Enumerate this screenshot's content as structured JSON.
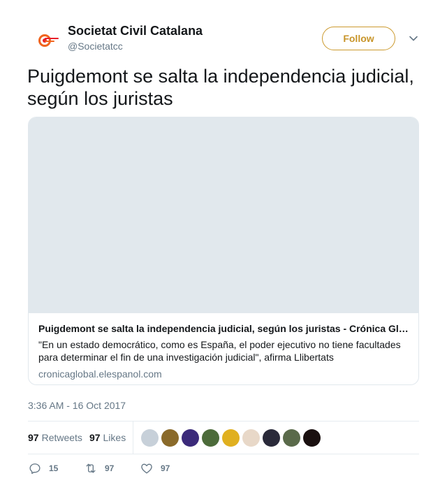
{
  "header": {
    "name": "Societat Civil Catalana",
    "handle": "@Societatcc",
    "follow_label": "Follow"
  },
  "tweet": {
    "text": "Puigdemont se salta la independencia judicial, según los juristas",
    "timestamp": "3:36 AM - 16 Oct 2017"
  },
  "card": {
    "title": "Puigdemont se salta la independencia judicial, según los juristas - Crónica Global",
    "description": "\"En un estado democrático, como es España, el poder ejecutivo no tiene facultades para determinar el fin de una investigación judicial\", afirma Llibertats",
    "domain": "cronicaglobal.elespanol.com"
  },
  "stats": {
    "retweets_count": "97",
    "retweets_label": "Retweets",
    "likes_count": "97",
    "likes_label": "Likes"
  },
  "liker_avatar_colors": [
    "#c7d0d9",
    "#8a6a2a",
    "#3b2a7a",
    "#4c6b3a",
    "#e0b020",
    "#e8d8c8",
    "#2a2a3a",
    "#5a6a4a",
    "#1a1010"
  ],
  "actions": {
    "reply_count": "15",
    "retweet_count": "97",
    "like_count": "97"
  },
  "icons": {
    "reply": "reply-icon",
    "retweet": "retweet-icon",
    "like": "heart-icon",
    "more": "chevron-down-icon"
  },
  "colors": {
    "follow_accent": "#c8952a",
    "secondary_text": "#657786",
    "card_placeholder": "#e1e8ed"
  }
}
